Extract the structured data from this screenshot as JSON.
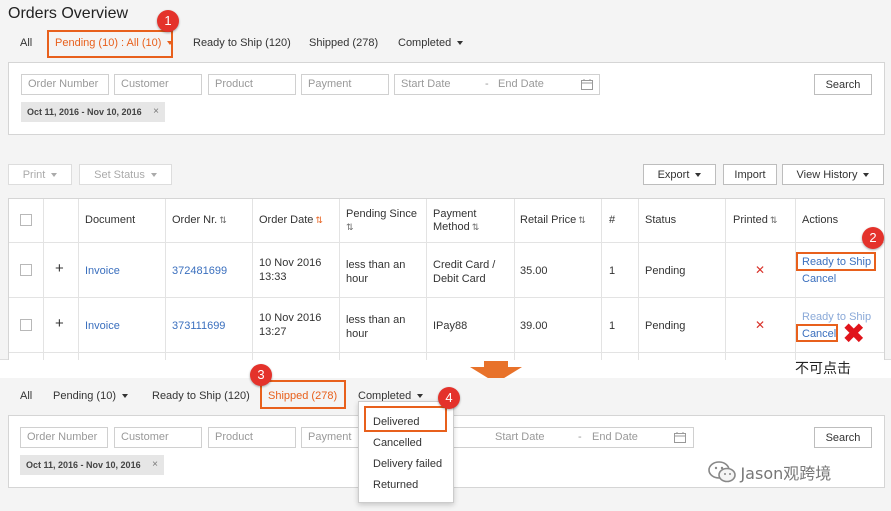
{
  "page_title": "Orders Overview",
  "top_tabs": {
    "all": "All",
    "pending": "Pending (10) : All (10)",
    "ready": "Ready to Ship (120)",
    "shipped": "Shipped (278)",
    "completed": "Completed"
  },
  "filters": {
    "order_number": "Order Number",
    "customer": "Customer",
    "product": "Product",
    "payment": "Payment",
    "start_date": "Start Date",
    "separator": "-",
    "end_date": "End Date",
    "search": "Search",
    "chip": "Oct 11, 2016 - Nov 10, 2016",
    "chip_close": "×"
  },
  "toolbar": {
    "print": "Print",
    "set_status": "Set Status",
    "export": "Export",
    "import": "Import",
    "view_history": "View History"
  },
  "table": {
    "headers": {
      "document": "Document",
      "order_nr": "Order Nr.",
      "order_date": "Order Date",
      "pending_since": "Pending Since",
      "payment_method": "Payment Method",
      "retail_price": "Retail Price",
      "qty": "#",
      "status": "Status",
      "printed": "Printed",
      "actions": "Actions"
    },
    "sort_icon": "⇅",
    "rows": [
      {
        "expand": "+",
        "document": "Invoice",
        "order_nr": "372481699",
        "date_line1": "10 Nov 2016",
        "date_line2": "13:33",
        "pending_line1": "less than an",
        "pending_line2": "hour",
        "pay_line1": "Credit Card /",
        "pay_line2": "Debit Card",
        "price": "35.00",
        "qty": "1",
        "status": "Pending",
        "printed": "✕",
        "action1": "Ready to Ship",
        "action2": "Cancel"
      },
      {
        "expand": "+",
        "document": "Invoice",
        "order_nr": "373111699",
        "date_line1": "10 Nov 2016",
        "date_line2": "13:27",
        "pending_line1": "less than an",
        "pending_line2": "hour",
        "pay_line1": "IPay88",
        "pay_line2": "",
        "price": "39.00",
        "qty": "1",
        "status": "Pending",
        "printed": "✕",
        "action1": "Ready to Ship",
        "action2": "Cancel"
      }
    ]
  },
  "annotations": {
    "b1": "1",
    "b2": "2",
    "b3": "3",
    "b4": "4",
    "not_clickable": "不可点击",
    "red_x_icon": "✖"
  },
  "bottom": {
    "tabs": {
      "all": "All",
      "pending": "Pending (10)",
      "ready": "Ready to Ship (120)",
      "shipped": "Shipped (278)",
      "completed": "Completed"
    },
    "dropdown": [
      "Delivered",
      "Cancelled",
      "Delivery failed",
      "Returned"
    ]
  },
  "watermark": "Jason观跨境",
  "colors": {
    "accent": "#e8601c",
    "badge": "#e4322b",
    "link": "#3a6fbe",
    "arrow": "#e8722a"
  }
}
